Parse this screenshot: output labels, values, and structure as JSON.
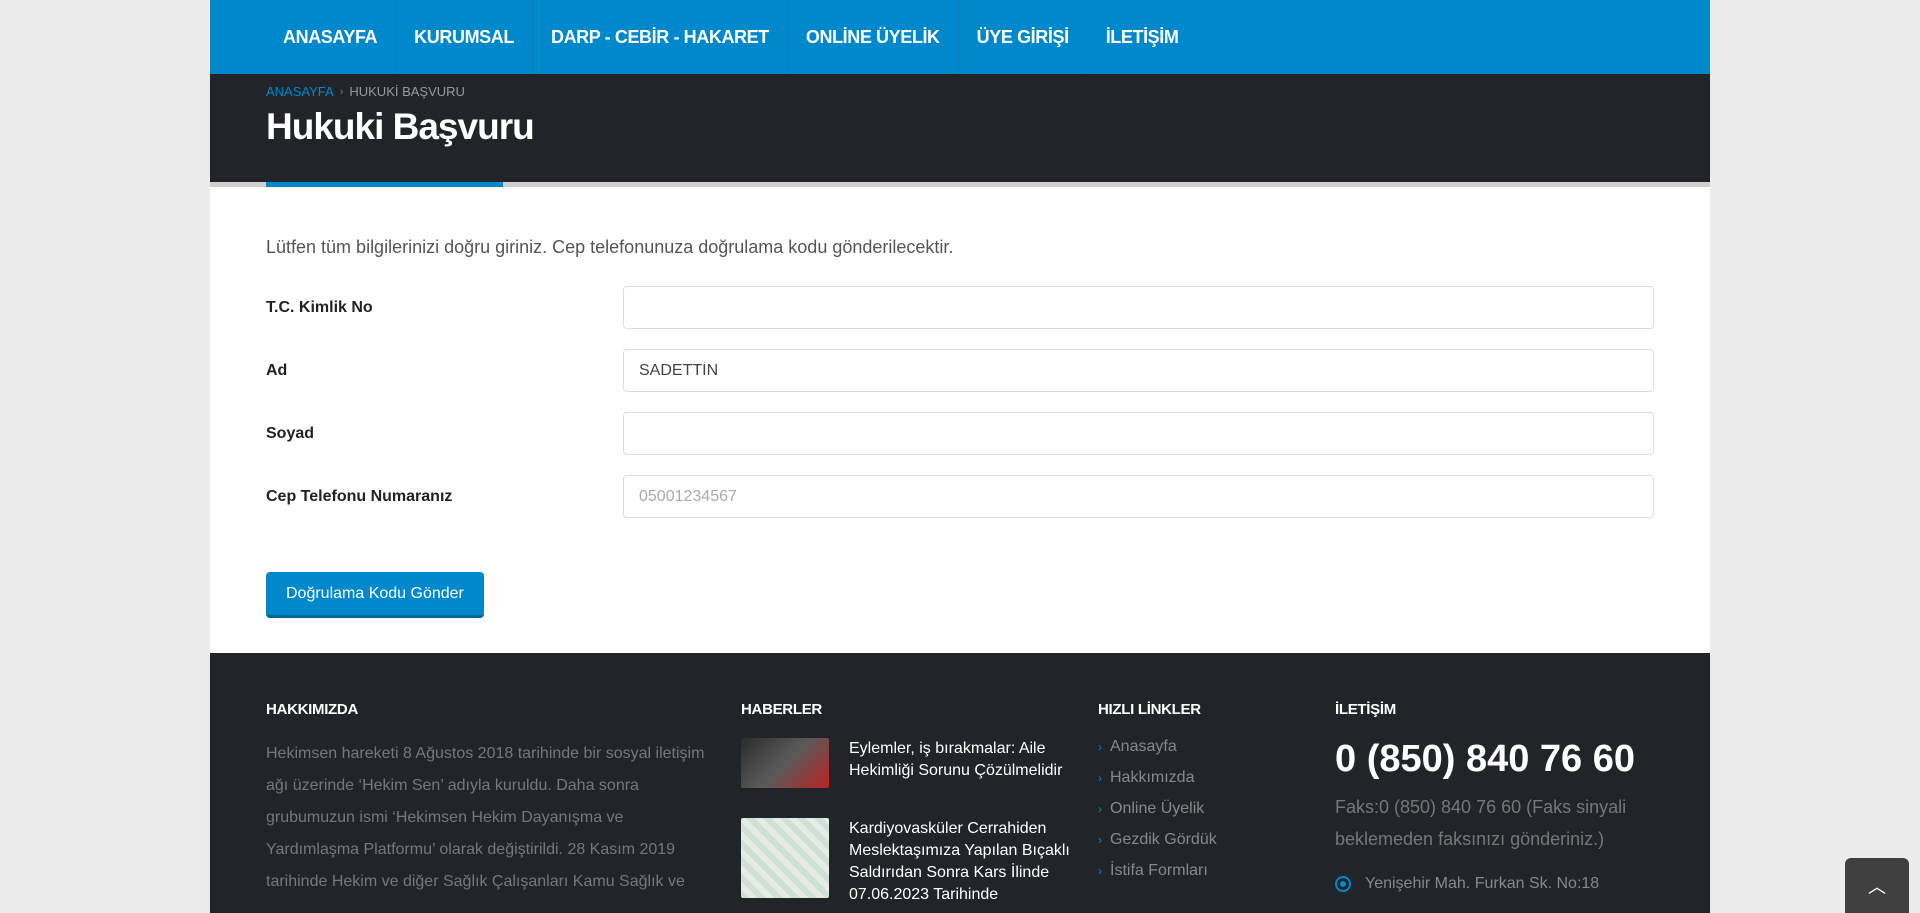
{
  "nav": {
    "items": [
      "ANASAYFA",
      "KURUMSAL",
      "DARP - CEBİR - HAKARET",
      "ONLİNE ÜYELİK",
      "ÜYE GİRİŞİ",
      "İLETİŞİM"
    ]
  },
  "breadcrumb": {
    "home": "ANASAYFA",
    "current": "HUKUKİ BAŞVURU"
  },
  "page": {
    "title": "Hukuki Başvuru"
  },
  "form": {
    "intro": "Lütfen tüm bilgilerinizi doğru giriniz. Cep telefonunuza doğrulama kodu gönderilecektir.",
    "fields": [
      {
        "label": "T.C. Kimlik No",
        "value": "",
        "placeholder": ""
      },
      {
        "label": "Ad",
        "value": "SADETTİN",
        "placeholder": ""
      },
      {
        "label": "Soyad",
        "value": "",
        "placeholder": ""
      },
      {
        "label": "Cep Telefonu Numaranız",
        "value": "",
        "placeholder": "05001234567"
      }
    ],
    "submit_label": "Doğrulama Kodu Gönder"
  },
  "footer": {
    "about": {
      "heading": "HAKKIMIZDA",
      "text": "Hekimsen hareketi 8 Ağustos 2018 tarihinde bir sosyal iletişim ağı üzerinde ‘Hekim Sen’ adıyla kuruldu. Daha sonra grubumuzun ismi ‘Hekimsen Hekim Dayanışma ve Yardımlaşma Platformu’ olarak değiştirildi. 28 Kasım 2019 tarihinde Hekim ve diğer Sağlık Çalışanları Kamu Sağlık ve"
    },
    "news": {
      "heading": "HABERLER",
      "items": [
        {
          "title": "Eylemler, iş bırakmalar: Aile Hekimliği Sorunu Çözülmelidir"
        },
        {
          "title": "Kardiyovasküler Cerrahiden Meslektaşımıza Yapılan Bıçaklı Saldırıdan Sonra Kars İlinde 07.06.2023 Tarihinde"
        }
      ]
    },
    "quick_links": {
      "heading": "HIZLI LİNKLER",
      "items": [
        "Anasayfa",
        "Hakkımızda",
        "Online Üyelik",
        "Gezdik Gördük",
        "İstifa Formları"
      ]
    },
    "contact": {
      "heading": "İLETİŞİM",
      "phone": "0 (850) 840 76 60",
      "fax": "Faks:0 (850) 840 76 60 (Faks sinyali beklemeden faksınızı gönderiniz.)",
      "address": "Yenişehir Mah. Furkan Sk. No:18"
    }
  },
  "colors": {
    "accent": "#0088cc",
    "dark": "#212529"
  }
}
